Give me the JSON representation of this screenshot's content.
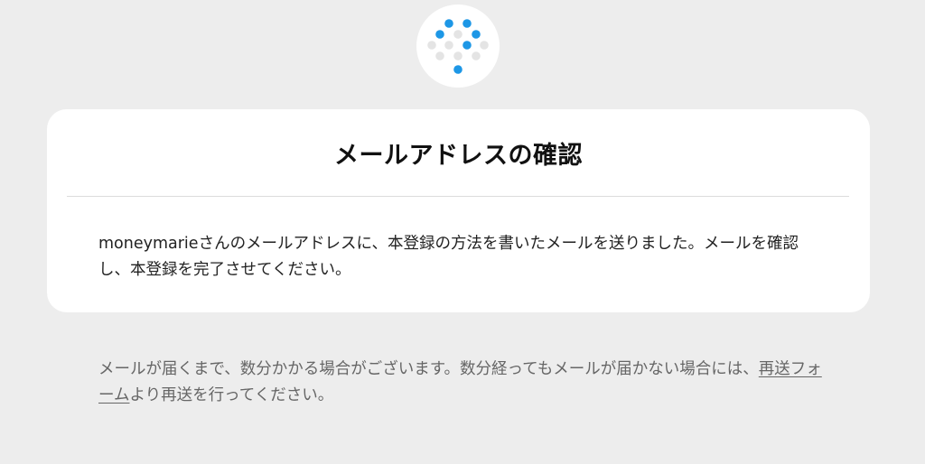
{
  "logo": {
    "icon": "dotted-heart-logo-icon",
    "accent_color": "#1d97e6",
    "dim_color": "#e4e4e4"
  },
  "card": {
    "title": "メールアドレスの確認",
    "message": "moneymarieさんのメールアドレスに、本登録の方法を書いたメールを送りました。メールを確認し、本登録を完了させてください。"
  },
  "note": {
    "text_before": "メールが届くまで、数分かかる場合がございます。数分経ってもメールが届かない場合には、",
    "link_label": "再送フォーム",
    "text_after": "より再送を行ってください。"
  }
}
